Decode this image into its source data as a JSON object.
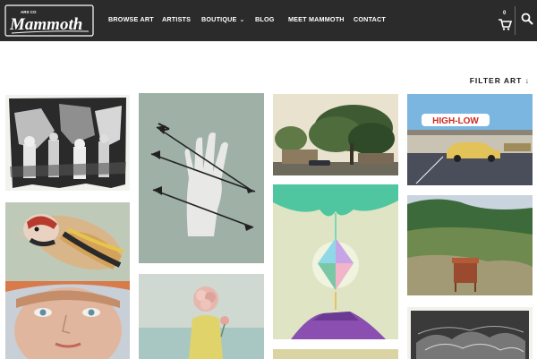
{
  "brand": {
    "logo_small_text": "ARS CO",
    "logo_text": "Mammoth"
  },
  "nav": {
    "items": [
      {
        "label": "BROWSE ART"
      },
      {
        "label": "ARTISTS"
      },
      {
        "label": "BOUTIQUE"
      },
      {
        "label": "BLOG"
      },
      {
        "label": "MEET MAMMOTH"
      },
      {
        "label": "CONTACT"
      }
    ],
    "boutique_chevron": "⌄"
  },
  "cart": {
    "count": "0"
  },
  "filter": {
    "label": "FILTER ART"
  },
  "artworks": [
    {
      "name": "black-and-white-figures-print"
    },
    {
      "name": "hand-with-arrows"
    },
    {
      "name": "oak-trees-street-photo"
    },
    {
      "name": "high-low-motel-sign-photo"
    },
    {
      "name": "bird-painting"
    },
    {
      "name": "crystal-drip-mountain"
    },
    {
      "name": "overgrown-field-chair-photo"
    },
    {
      "name": "woman-portrait-painting"
    },
    {
      "name": "girl-with-flower-head"
    },
    {
      "name": "etched-rocks-print"
    }
  ],
  "motel_sign_text": "HIGH-LOW",
  "colors": {
    "navbar": "#2b2b2b",
    "background": "#ffffff"
  }
}
